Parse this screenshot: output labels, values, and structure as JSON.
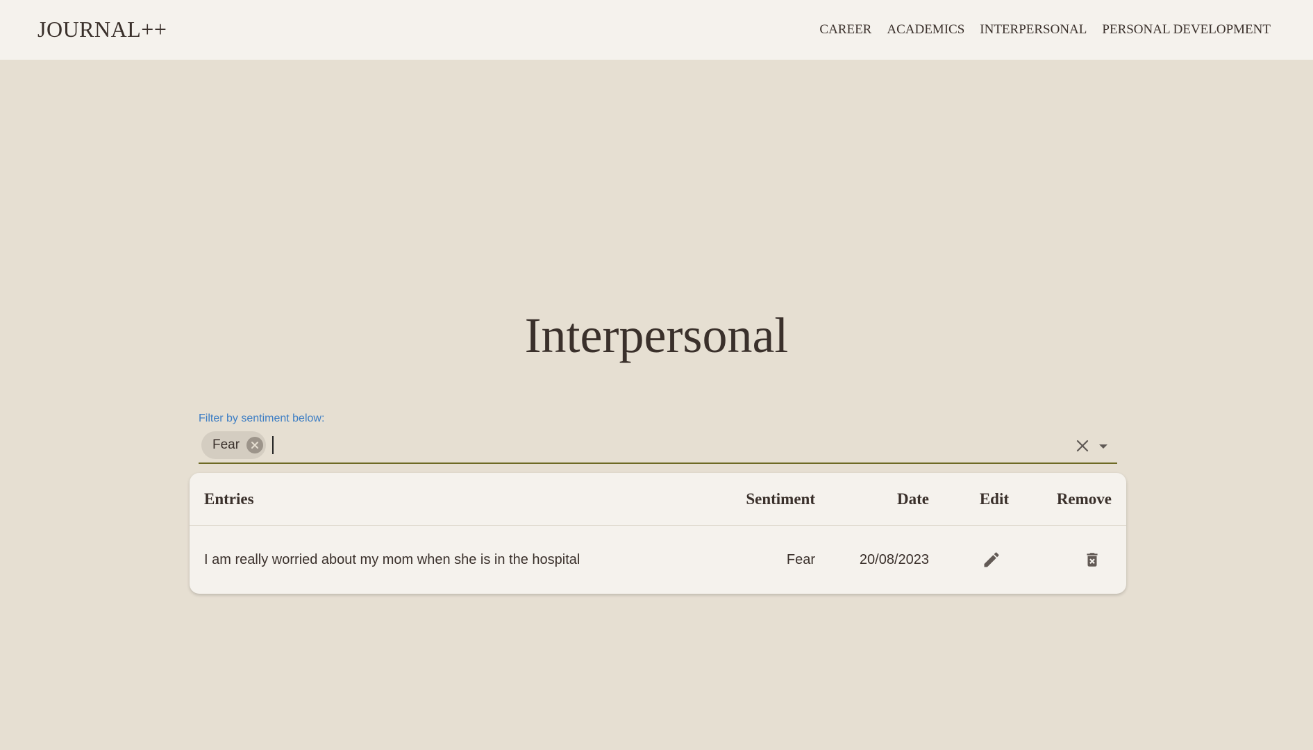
{
  "app": {
    "title": "JOURNAL++"
  },
  "nav": {
    "items": [
      {
        "label": "CAREER"
      },
      {
        "label": "ACADEMICS"
      },
      {
        "label": "INTERPERSONAL"
      },
      {
        "label": "PERSONAL DEVELOPMENT"
      }
    ]
  },
  "page": {
    "title": "Interpersonal"
  },
  "filter": {
    "label": "Filter by sentiment below:",
    "chips": [
      {
        "label": "Fear"
      }
    ],
    "value": ""
  },
  "table": {
    "headers": {
      "entries": "Entries",
      "sentiment": "Sentiment",
      "date": "Date",
      "edit": "Edit",
      "remove": "Remove"
    },
    "rows": [
      {
        "entry": "I am really worried about my mom when she is in the hospital",
        "sentiment": "Fear",
        "date": "20/08/2023"
      }
    ]
  },
  "colors": {
    "background": "#e6dfd2",
    "surface": "#f5f2ed",
    "text": "#3a302b",
    "label_accent": "#3c7dc4",
    "underline": "#6e6a25",
    "chip": "#d4cdc1"
  },
  "icons": {
    "chip_remove": "cancel-circle-icon",
    "clear": "close-icon",
    "dropdown": "arrow-drop-down-icon",
    "edit": "pencil-icon",
    "remove": "delete-forever-icon"
  }
}
